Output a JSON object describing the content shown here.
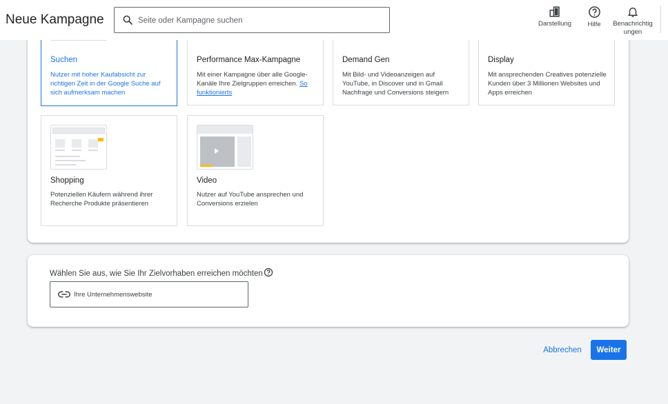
{
  "header": {
    "title": "Neue Kampagne",
    "search_placeholder": "Seite oder Kampagne suchen",
    "buttons": [
      {
        "label": "Darstellung",
        "icon": "appearance-icon"
      },
      {
        "label": "Hilfe",
        "icon": "help-icon"
      },
      {
        "label": "Benachrichtigungen",
        "icon": "bell-icon"
      }
    ]
  },
  "campaign_types": [
    {
      "title": "Suchen",
      "desc": "Nutzer mit hoher Kaufabsicht zur richtigen Zeit in der Google Suche auf sich aufmerksam machen",
      "selected": true
    },
    {
      "title": "Performance Max-Kampagne",
      "desc": "Mit einer Kampagne über alle Google-Kanäle Ihre Zielgruppen erreichen.",
      "link": "So funktionierts",
      "selected": false
    },
    {
      "title": "Demand Gen",
      "desc": "Mit Bild- und Videoanzeigen auf YouTube, in Discover und in Gmail Nachfrage und Conversions steigern",
      "selected": false
    },
    {
      "title": "Display",
      "desc": "Mit ansprechenden Creatives potenzielle Kunden über 3 Millionen Websites und Apps erreichen",
      "selected": false
    },
    {
      "title": "Shopping",
      "desc": "Potenziellen Käufern während ihrer Recherche Produkte präsentieren",
      "selected": false
    },
    {
      "title": "Video",
      "desc": "Nutzer auf YouTube ansprechen und Conversions erzielen",
      "selected": false
    }
  ],
  "goal": {
    "label": "Wählen Sie aus, wie Sie Ihr Zielvorhaben erreichen möchten",
    "option": "Ihre Unternehmenswebsite"
  },
  "actions": {
    "cancel": "Abbrechen",
    "next": "Weiter"
  },
  "colors": {
    "accent": "#1a73e8",
    "yellow": "#fbbc04",
    "border": "#dadce0",
    "background": "#f1f3f4"
  }
}
